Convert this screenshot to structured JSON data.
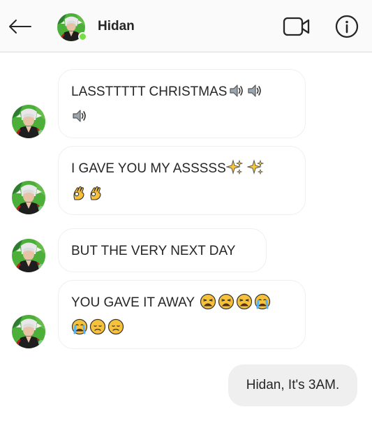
{
  "header": {
    "back_icon": "arrow-left-icon",
    "contact_name": "Hidan",
    "online": true,
    "video_icon": "video-camera-icon",
    "info_icon": "info-circle-icon"
  },
  "messages": [
    {
      "sender": "Hidan",
      "lines": [
        {
          "text": "LASSTTTTT CHRISTMAS",
          "emojis": [
            "speaker-loud",
            "speaker-loud"
          ]
        },
        {
          "text": "",
          "emojis": [
            "speaker-loud"
          ]
        }
      ]
    },
    {
      "sender": "Hidan",
      "lines": [
        {
          "text": "I GAVE YOU MY ASSSSS",
          "emojis": [
            "sparkles",
            "sparkles"
          ]
        },
        {
          "text": "",
          "emojis": [
            "ok-hand",
            "ok-hand"
          ]
        }
      ]
    },
    {
      "sender": "Hidan",
      "lines": [
        {
          "text": "BUT THE VERY NEXT DAY",
          "emojis": []
        }
      ]
    },
    {
      "sender": "Hidan",
      "lines": [
        {
          "text": "YOU GAVE IT AWAY",
          "emojis": [
            "weary-face",
            "weary-face",
            "weary-face",
            "crying-face"
          ]
        },
        {
          "text": "",
          "emojis": [
            "crying-face",
            "disappointed-face",
            "disappointed-face"
          ]
        }
      ]
    }
  ],
  "sent_message": {
    "sender": "me",
    "text": "Hidan, It's 3AM."
  },
  "colors": {
    "header_bg": "#fafafa",
    "online_dot": "#78de45",
    "sent_bubble": "#efefef",
    "received_border": "#efefef",
    "text": "#262626"
  }
}
